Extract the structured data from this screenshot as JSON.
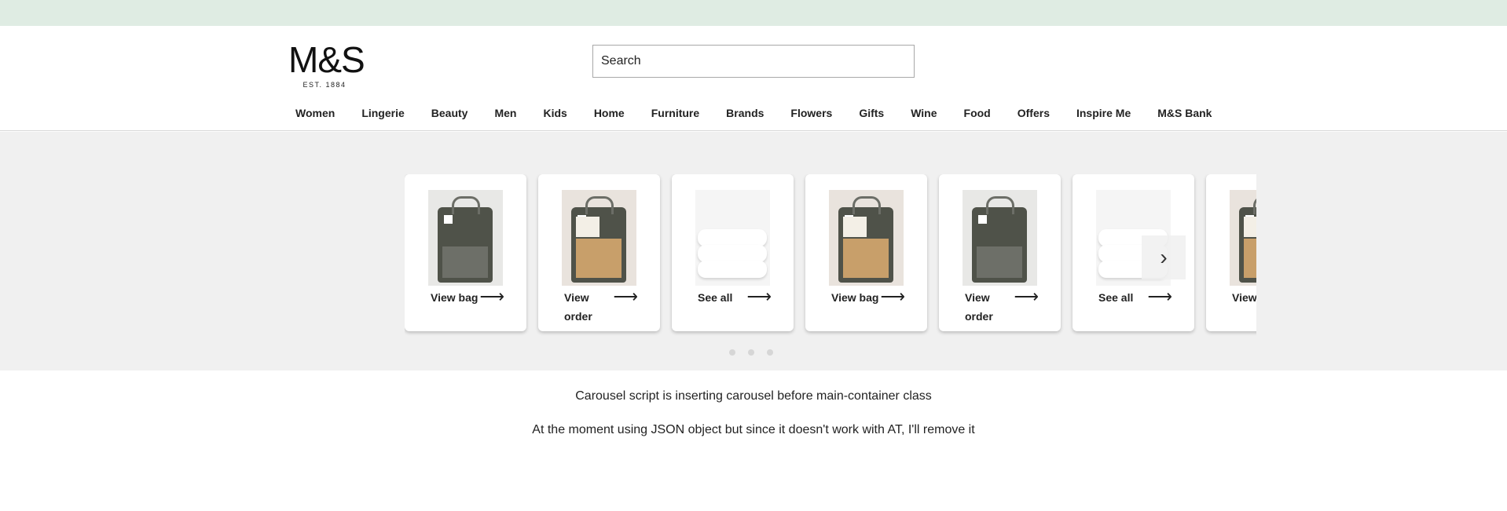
{
  "logo": {
    "main": "M&S",
    "sub": "EST. 1884"
  },
  "search": {
    "placeholder": "Search"
  },
  "nav": [
    "Women",
    "Lingerie",
    "Beauty",
    "Men",
    "Kids",
    "Home",
    "Furniture",
    "Brands",
    "Flowers",
    "Gifts",
    "Wine",
    "Food",
    "Offers",
    "Inspire Me",
    "M&S Bank"
  ],
  "carousel": {
    "cards": [
      {
        "image": "green-bag",
        "label": "View bag"
      },
      {
        "image": "beige-bag",
        "label": "View order"
      },
      {
        "image": "white-duvet",
        "label": "See all"
      },
      {
        "image": "beige-bag",
        "label": "View bag"
      },
      {
        "image": "green-bag",
        "label": "View order"
      },
      {
        "image": "white-duvet",
        "label": "See all"
      },
      {
        "image": "beige-bag",
        "label": "View"
      }
    ],
    "arrow_icon": "arrow-right-icon",
    "next_icon": "chevron-right-icon",
    "dots": 3
  },
  "notes": [
    "Carousel script is inserting carousel before main-container class",
    "At the moment using JSON object but since it doesn't work with AT, I'll remove it"
  ],
  "colors": {
    "topbar": "#dfece3",
    "band": "#f0f0f0"
  }
}
